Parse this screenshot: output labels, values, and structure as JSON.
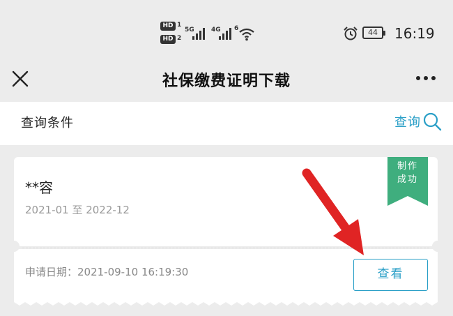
{
  "status_bar": {
    "hd1": "HD",
    "hd1_num": "1",
    "hd2": "HD",
    "hd2_num": "2",
    "net1": "5G",
    "net2": "4G",
    "wifi_level": "6",
    "battery": "44",
    "time": "16:19",
    "icons": [
      "signal-icon",
      "wifi-icon",
      "alarm-icon",
      "battery-icon"
    ]
  },
  "nav": {
    "title": "社保缴费证明下载",
    "icons": [
      "close-icon",
      "more-icon"
    ]
  },
  "query": {
    "label": "查询条件",
    "action_label": "查询",
    "icon": "search-icon"
  },
  "card": {
    "name": "**容",
    "period": "2021-01 至 2022-12",
    "apply_date": "申请日期：2021-09-10 16:19:30",
    "status_line1": "制作",
    "status_line2": "成功",
    "view_label": "查看"
  },
  "colors": {
    "accent": "#2a9fc7",
    "status_green": "#3fae7e",
    "arrow_red": "#e02424",
    "background": "#ececec"
  }
}
